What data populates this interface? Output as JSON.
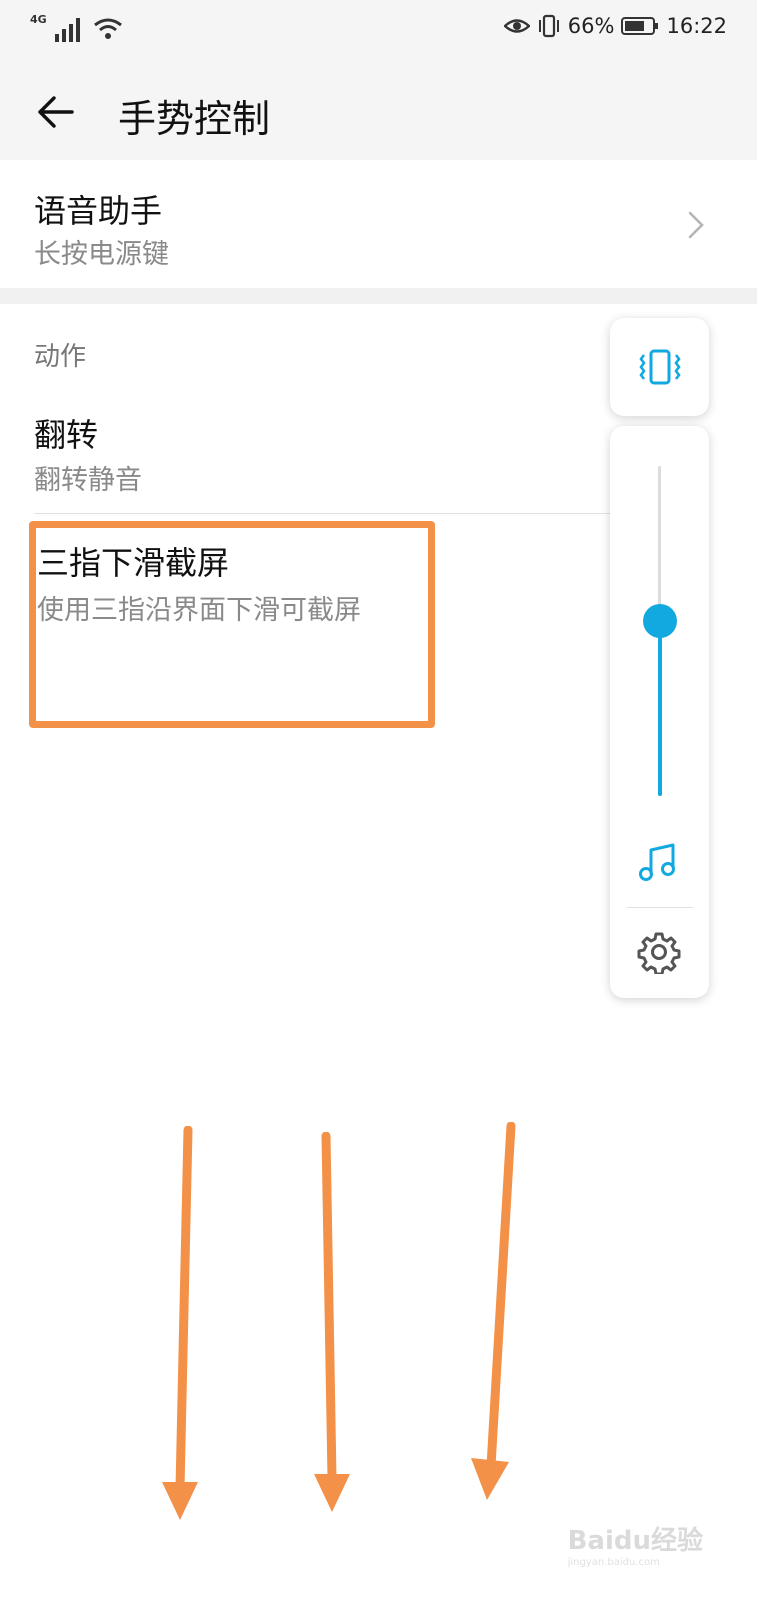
{
  "status_bar": {
    "network": "4G",
    "battery_percent": "66%",
    "time": "16:22",
    "icons": [
      "signal-icon",
      "wifi-icon",
      "eye-comfort-icon",
      "vibrate-icon",
      "battery-icon"
    ]
  },
  "header": {
    "title": "手势控制",
    "back_icon": "arrow-left-icon"
  },
  "voice_assistant": {
    "title": "语音助手",
    "subtitle": "长按电源键"
  },
  "actions_section": {
    "label": "动作",
    "items": [
      {
        "title": "翻转",
        "subtitle": "翻转静音"
      },
      {
        "title": "三指下滑截屏",
        "subtitle": "使用三指沿界面下滑可截屏"
      }
    ]
  },
  "volume_panel": {
    "mode_icon": "vibrate-icon",
    "stream_icon": "music-note-icon",
    "settings_icon": "gear-icon",
    "level": 0.53,
    "accent_color": "#12a9e0"
  },
  "annotation": {
    "highlight_color": "#f39149",
    "arrow_count": 3
  },
  "watermark": {
    "text": "Baidu经验",
    "sub": "jingyan.baidu.com"
  }
}
